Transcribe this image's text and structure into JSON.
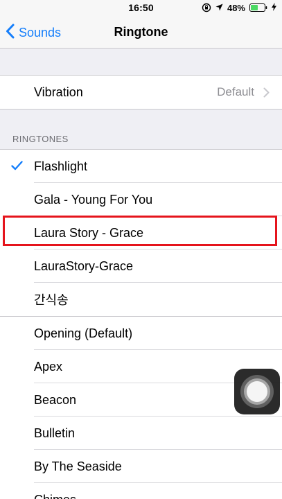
{
  "status_bar": {
    "time": "16:50",
    "battery_percent": "48%",
    "icons": [
      "rotation-lock-icon",
      "location-icon",
      "battery-icon",
      "charging-icon"
    ]
  },
  "nav": {
    "back_label": "Sounds",
    "title": "Ringtone"
  },
  "vibration": {
    "label": "Vibration",
    "value": "Default"
  },
  "ringtones_header": "RINGTONES",
  "custom_ringtones": [
    {
      "label": "Flashlight",
      "selected": true
    },
    {
      "label": "Gala - Young For You",
      "selected": false
    },
    {
      "label": "Laura Story - Grace",
      "selected": false
    },
    {
      "label": "LauraStory-Grace",
      "selected": false
    },
    {
      "label": "간식송",
      "selected": false
    }
  ],
  "builtin_ringtones": [
    {
      "label": "Opening (Default)"
    },
    {
      "label": "Apex"
    },
    {
      "label": "Beacon"
    },
    {
      "label": "Bulletin"
    },
    {
      "label": "By The Seaside"
    },
    {
      "label": "Chimes"
    }
  ],
  "colors": {
    "accent": "#147efb",
    "highlight": "#e5141c",
    "background": "#efeff4"
  }
}
